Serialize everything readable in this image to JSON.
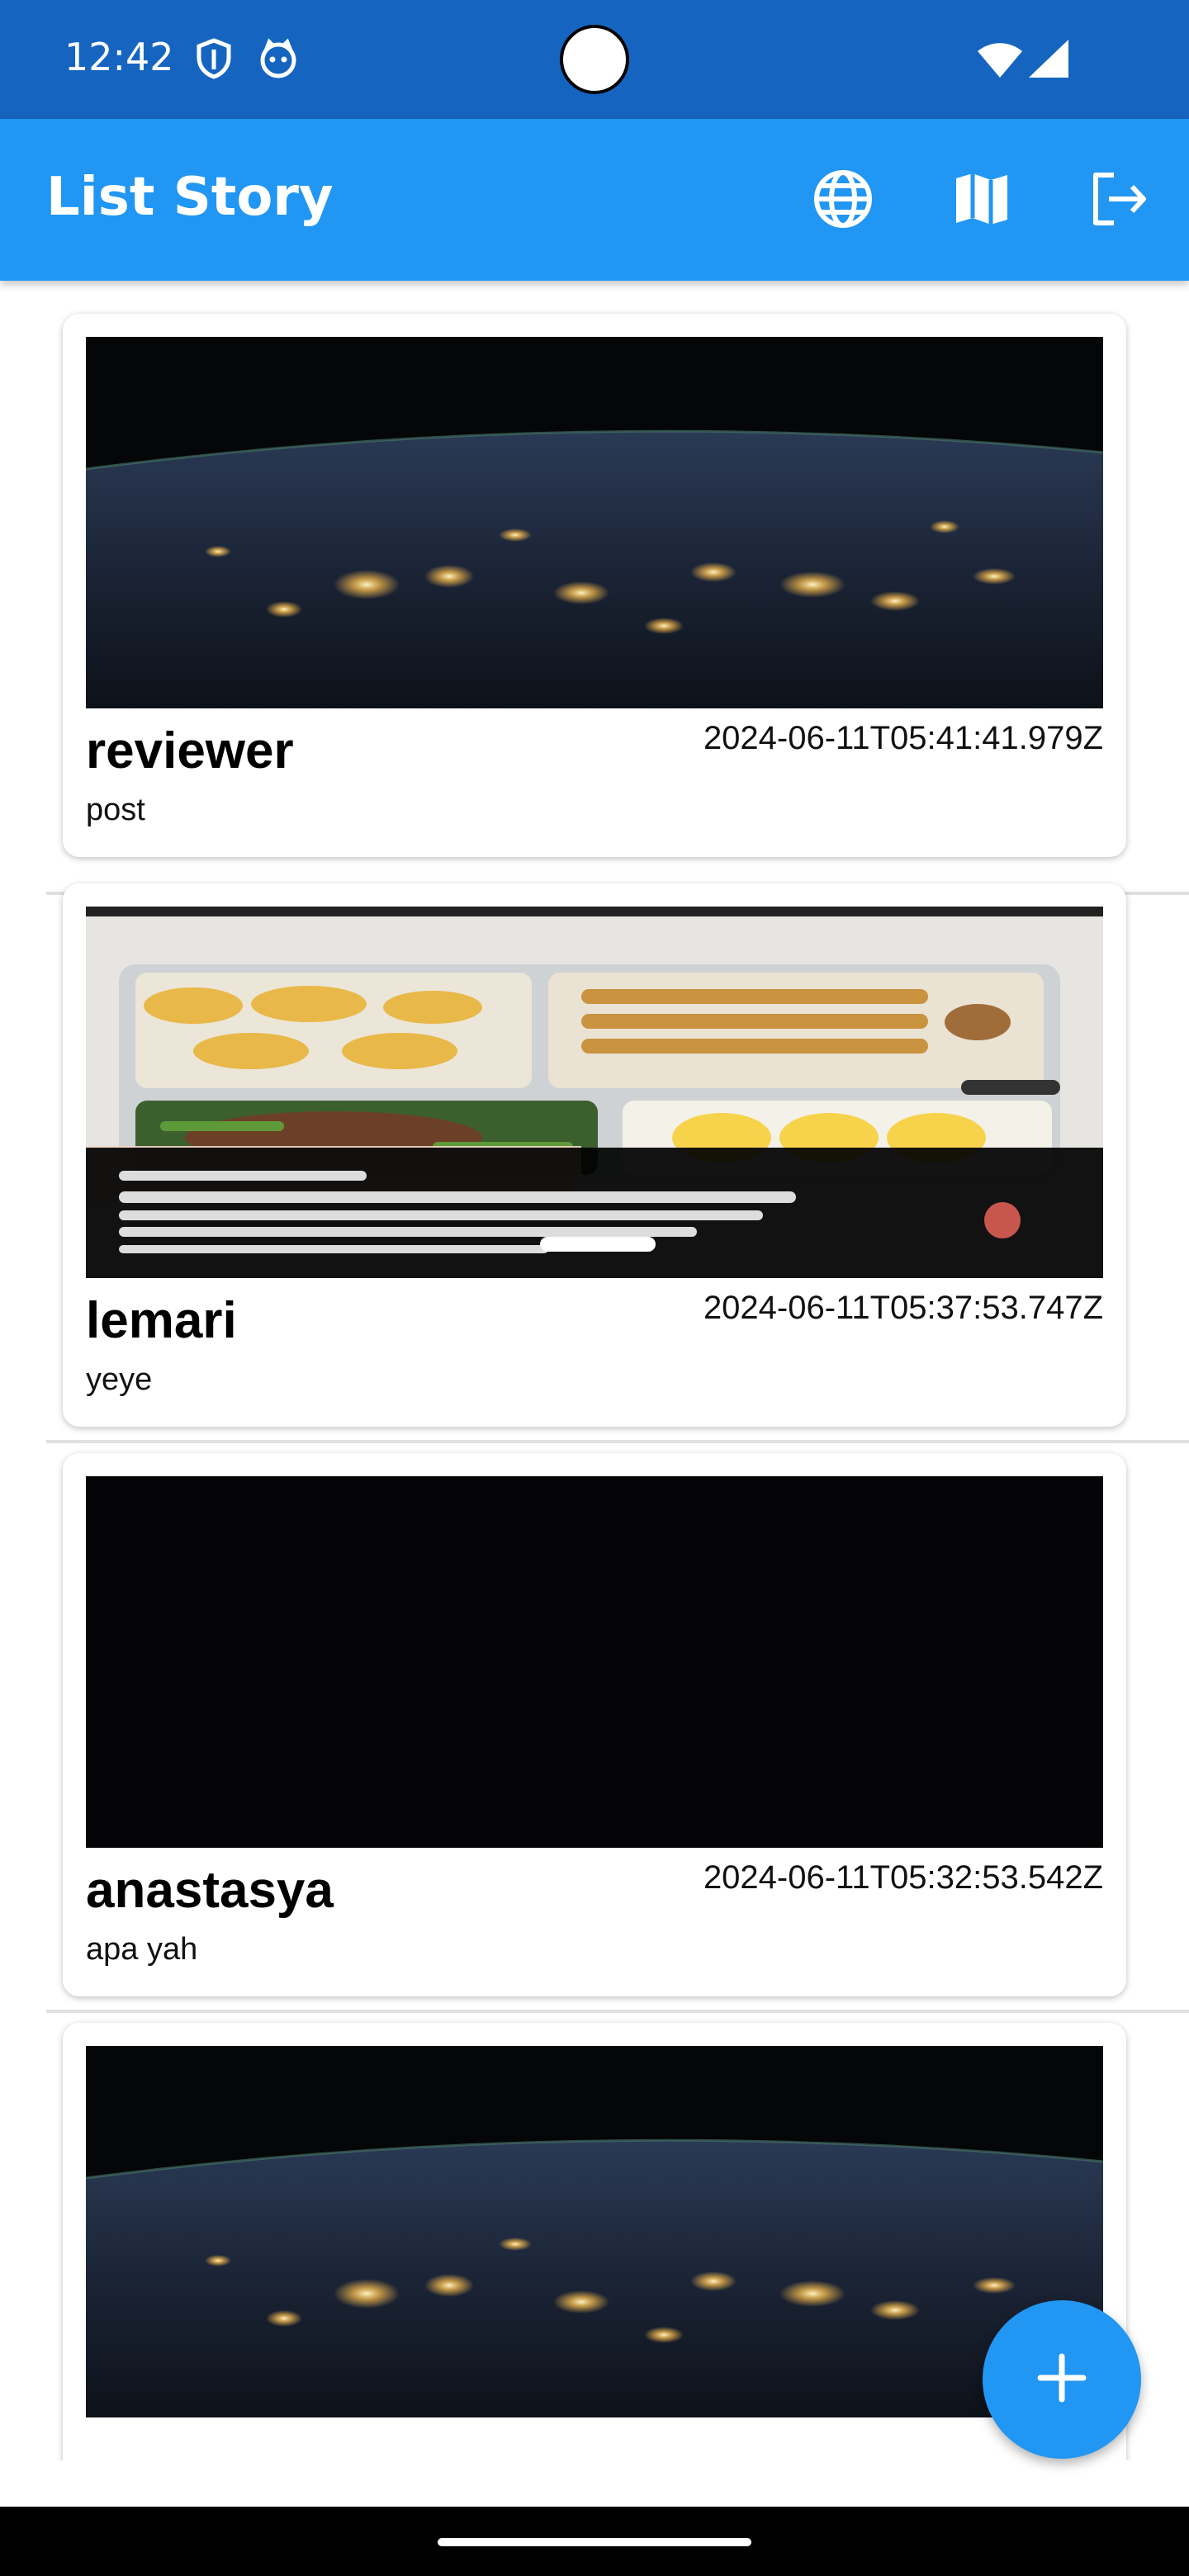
{
  "status_bar": {
    "time": "12:42",
    "icons": [
      "shield-icon",
      "cat-face-icon",
      "wifi-icon",
      "signal-icon"
    ]
  },
  "app_bar": {
    "title": "List Story",
    "actions": [
      "language-icon",
      "map-icon",
      "logout-icon"
    ],
    "color": "#2196F3"
  },
  "stories": [
    {
      "name": "reviewer",
      "date": "2024-06-11T05:41:41.979Z",
      "description": "post",
      "image": "earth-at-night"
    },
    {
      "name": "lemari",
      "date": "2024-06-11T05:37:53.747Z",
      "description": "yeye",
      "image": "food-box-screenshot"
    },
    {
      "name": "anastasya",
      "date": "2024-06-11T05:32:53.542Z",
      "description": "apa yah",
      "image": "black"
    },
    {
      "name": "",
      "date": "",
      "description": "",
      "image": "earth-at-night"
    }
  ],
  "fab": {
    "icon": "plus-icon",
    "color": "#2196F3"
  },
  "colors": {
    "status_bar": "#1565C0",
    "app_bar": "#2196F3"
  }
}
